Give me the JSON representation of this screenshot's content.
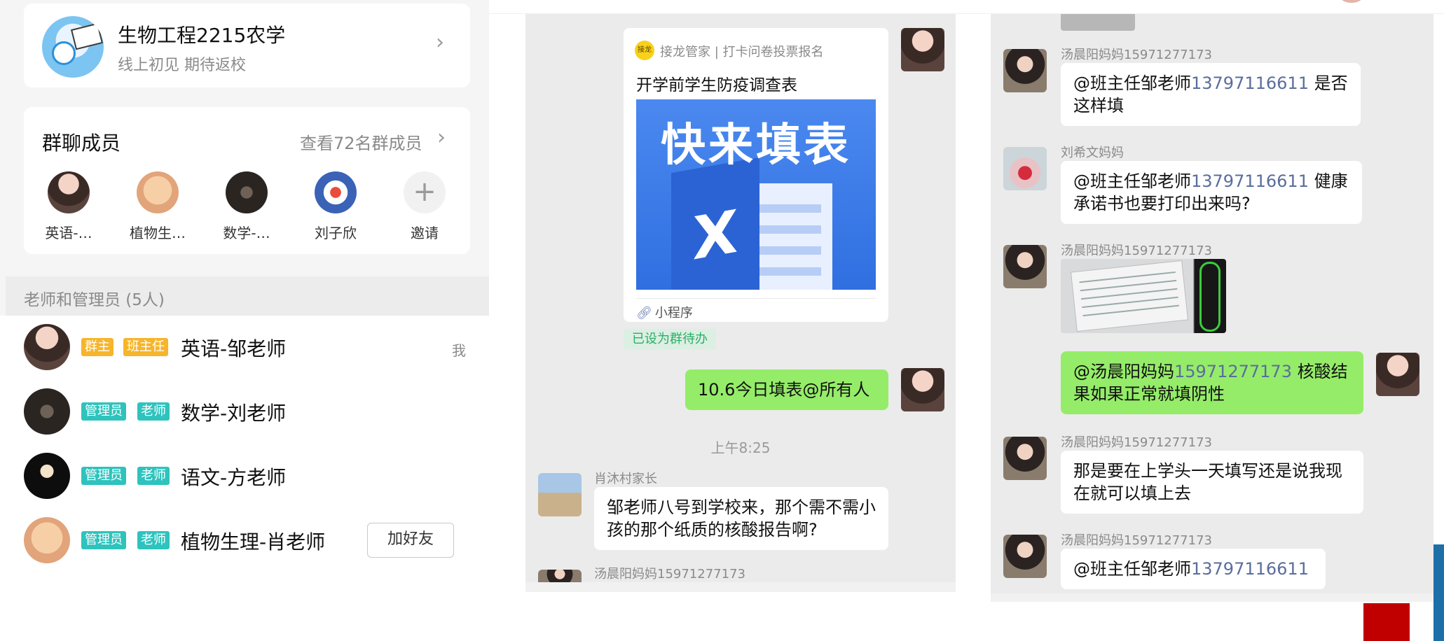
{
  "group_info": {
    "name": "生物工程2215农学",
    "subtitle": "线上初见 期待返校",
    "avatar_icon": "doraemon-avatar"
  },
  "members": {
    "title": "群聊成员",
    "view_all": "查看72名群成员",
    "list": [
      {
        "label": "英语-…",
        "icon": "girl-avatar"
      },
      {
        "label": "植物生…",
        "icon": "baby-avatar"
      },
      {
        "label": "数学-…",
        "icon": "dark-poster-avatar"
      },
      {
        "label": "刘子欣",
        "icon": "robot-avatar"
      }
    ],
    "invite_label": "邀请",
    "invite_icon": "plus-icon"
  },
  "teachers_section": {
    "title": "老师和管理员 (5人)",
    "rows": [
      {
        "badges": [
          "群主",
          "班主任"
        ],
        "name": "英语-邹老师",
        "suffix": "我"
      },
      {
        "badges": [
          "管理员",
          "老师"
        ],
        "name": "数学-刘老师"
      },
      {
        "badges": [
          "管理员",
          "老师"
        ],
        "name": "语文-方老师"
      },
      {
        "badges": [
          "管理员",
          "老师"
        ],
        "name": "植物生理-肖老师",
        "action": "加好友"
      }
    ]
  },
  "middle_chat": {
    "mini_program": {
      "source": "接龙管家 | 打卡问卷投票报名",
      "logo_text": "接龙",
      "title": "开学前学生防疫调查表",
      "cover_text": "快来填表",
      "cover_icon": "excel-x-icon",
      "tag": "小程序",
      "tag_icon": "link-icon"
    },
    "todo_tag": "已设为群待办",
    "green_message": "10.6今日填表@所有人",
    "time": "上午8:25",
    "sender_1": "肖沐村家长",
    "message_1": "邹老师八号到学校来，那个需不需小孩的那个纸质的核酸报告啊?",
    "sender_2": "汤晨阳妈妈15971277173"
  },
  "right_chat": {
    "messages": [
      {
        "sender": "汤晨阳妈妈15971277173",
        "prefix": "@班主任邹老师",
        "mention": "13797116611",
        "suffix": " 是否这样填"
      },
      {
        "sender": "刘希文妈妈",
        "prefix": "@班主任邹老师",
        "mention": "13797116611",
        "suffix": " 健康承诺书也要打印出来吗?"
      },
      {
        "sender": "汤晨阳妈妈15971277173",
        "image": "health-form-photo"
      },
      {
        "prefix": "@汤晨阳妈妈",
        "mention": "15971277173",
        "suffix": " 核酸结果如果正常就填阴性"
      },
      {
        "sender": "汤晨阳妈妈15971277173",
        "text": "那是要在上学头一天填写还是说我现在就可以填上去"
      },
      {
        "sender": "汤晨阳妈妈15971277173",
        "prefix": "@班主任邹老师",
        "mention": "13797116611",
        "suffix": ""
      }
    ]
  },
  "colors": {
    "accent_green": "#95ec69",
    "badge_orange": "#f6b52a",
    "badge_teal": "#2ec3bd",
    "mention_blue": "#5a6d9c"
  }
}
